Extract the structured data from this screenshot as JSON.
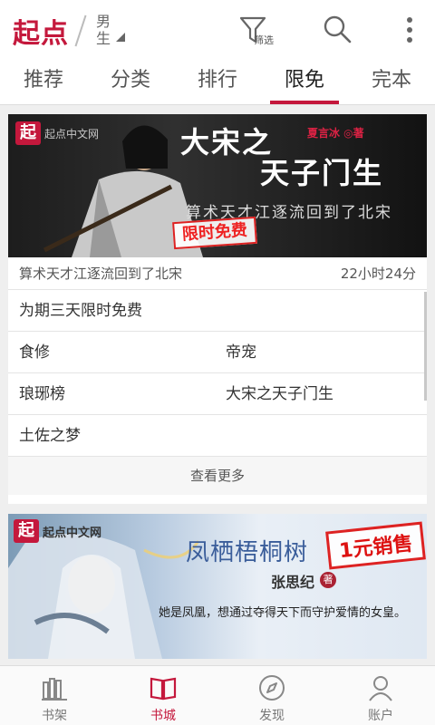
{
  "header": {
    "logo": "起点",
    "gender_line1": "男",
    "gender_line2": "生",
    "filter_label": "筛选"
  },
  "tabs": [
    {
      "label": "推荐",
      "active": false
    },
    {
      "label": "分类",
      "active": false
    },
    {
      "label": "排行",
      "active": false
    },
    {
      "label": "限免",
      "active": true
    },
    {
      "label": "完本",
      "active": false
    }
  ],
  "card1": {
    "banner": {
      "brand_badge": "起",
      "brand_text": "起点中文网",
      "title_line1": "大宋之",
      "title_line2": "天子门生",
      "author": "夏言冰 ◎著",
      "tagline": "算术天才江逐流回到了北宋",
      "stamp": "限时免费"
    },
    "meta_text": "算术天才江逐流回到了北宋",
    "time_left": "22小时24分",
    "period_text": "为期三天限时免费",
    "books": [
      [
        "食修",
        "帝宠"
      ],
      [
        "琅琊榜",
        "大宋之天子门生"
      ],
      [
        "土佐之梦",
        ""
      ]
    ],
    "more_label": "查看更多"
  },
  "card2": {
    "banner": {
      "brand_badge": "起",
      "brand_text": "起点中文网",
      "title": "凤栖梧桐树",
      "stamp": "1元销售",
      "author": "张思纪",
      "author_mark": "著",
      "description": "她是凤凰，想通过夺得天下而守护爱情的女皇。"
    }
  },
  "bottom_nav": [
    {
      "label": "书架",
      "icon": "bookshelf-icon",
      "active": false
    },
    {
      "label": "书城",
      "icon": "book-open-icon",
      "active": true
    },
    {
      "label": "发现",
      "icon": "compass-icon",
      "active": false
    },
    {
      "label": "账户",
      "icon": "user-icon",
      "active": false
    }
  ],
  "colors": {
    "accent": "#c4183c",
    "text": "#333333",
    "background": "#efefef"
  }
}
